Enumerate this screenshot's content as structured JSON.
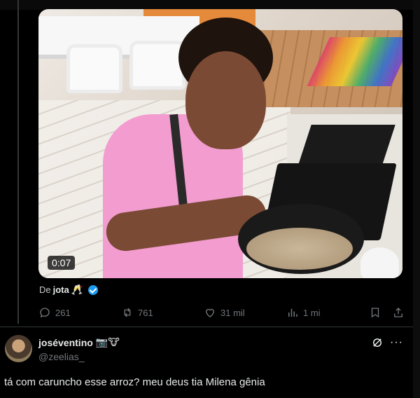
{
  "video": {
    "duration": "0:07"
  },
  "attribution": {
    "prefix": "De",
    "name": "jota",
    "emoji": "🥂",
    "verified_color": "#1d9bf0"
  },
  "actions": {
    "replies": "261",
    "reposts": "761",
    "likes": "31 mil",
    "views": "1 mi",
    "icon_color": "#71767b"
  },
  "reply": {
    "name": "joséventino",
    "name_emojis": "📷🐮",
    "handle": "@zeelias_",
    "text": "tá com caruncho esse arroz? meu deus tia Milena gênia"
  },
  "colors": {
    "background": "#000000",
    "text": "#e7e9ea",
    "muted": "#71767b",
    "divider": "#2f3336"
  }
}
